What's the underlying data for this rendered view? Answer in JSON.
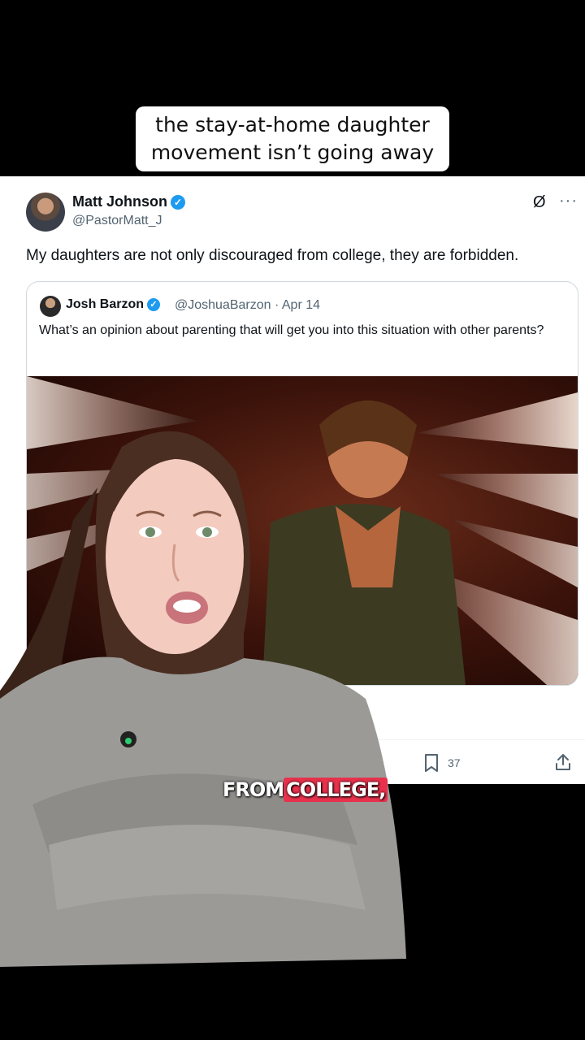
{
  "caption": {
    "line1": "the stay-at-home daughter",
    "line2": "movement isn’t going away"
  },
  "tweet": {
    "author_name": "Matt Johnson",
    "author_handle": "@PastorMatt_J",
    "verified_icon": "✓",
    "grok_icon": "Ø",
    "more_icon": "···",
    "text": "My daughters are not only discouraged from college, they are forbidden.",
    "quote": {
      "author_name": "Josh Barzon",
      "author_handle": "@JoshuaBarzon",
      "date": "Apr 14",
      "meta": "@JoshuaBarzon · Apr 14",
      "text": "What’s an opinion about parenting that will get you into this situation with other parents?"
    },
    "actions": {
      "bookmark_count": "37"
    }
  },
  "subtitle": {
    "word1": "FROM",
    "word2": "COLLEGE,"
  },
  "colors": {
    "verified": "#1d9bf0",
    "highlight": "#e8314c"
  }
}
